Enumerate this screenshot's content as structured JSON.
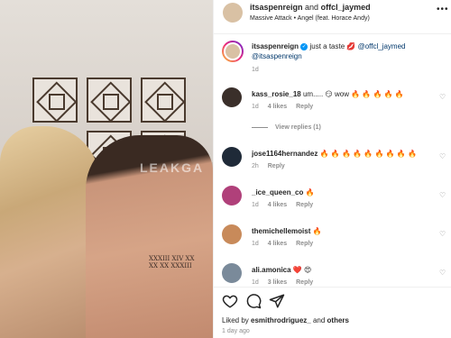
{
  "header": {
    "username": "itsaspenreign",
    "and_text": "and",
    "collaborator": "offcl_jaymed",
    "audio": "Massive Attack • Angel (feat. Horace Andy)",
    "more_icon": "more-horizontal-icon"
  },
  "photo": {
    "watermark": "LEAKGA",
    "tattoo_line1": "XXXIII XIV XX",
    "tattoo_line2": "XX XX XXXIII"
  },
  "caption": {
    "username": "itsaspenreign",
    "text": "just a taste 💋",
    "mention1": "@offcl_jaymed",
    "mention2": "@itsaspenreign",
    "time": "1d"
  },
  "comments": [
    {
      "username": "kass_rosie_18",
      "text": "um..... 😏 wow 🔥 🔥 🔥 🔥 🔥",
      "time": "1d",
      "likes": "4 likes",
      "reply": "Reply",
      "avatar_color": "#3a2f2a"
    },
    {
      "username": "jose1164hernandez",
      "text": "🔥 🔥 🔥 🔥 🔥 🔥 🔥 🔥 🔥",
      "time": "2h",
      "likes": "",
      "reply": "Reply",
      "avatar_color": "#1f2a38"
    },
    {
      "username": "_ice_queen_co",
      "text": "🔥",
      "time": "1d",
      "likes": "4 likes",
      "reply": "Reply",
      "avatar_color": "#b0407a"
    },
    {
      "username": "themichellemoist",
      "text": "🔥",
      "time": "1d",
      "likes": "4 likes",
      "reply": "Reply",
      "avatar_color": "#c88a5a"
    },
    {
      "username": "ali.amonica",
      "text": "❤️ 😍",
      "time": "1d",
      "likes": "3 likes",
      "reply": "Reply",
      "avatar_color": "#7a8a9a"
    }
  ],
  "view_replies": "View replies (1)",
  "footer": {
    "liked_by_prefix": "Liked by",
    "liked_by_user": "esmithrodriguez_",
    "and_others_prefix": "and",
    "others": "others",
    "time": "1 day ago"
  },
  "colors": {
    "link": "#00376b",
    "muted": "#8e8e8e",
    "verified": "#0095f6"
  }
}
